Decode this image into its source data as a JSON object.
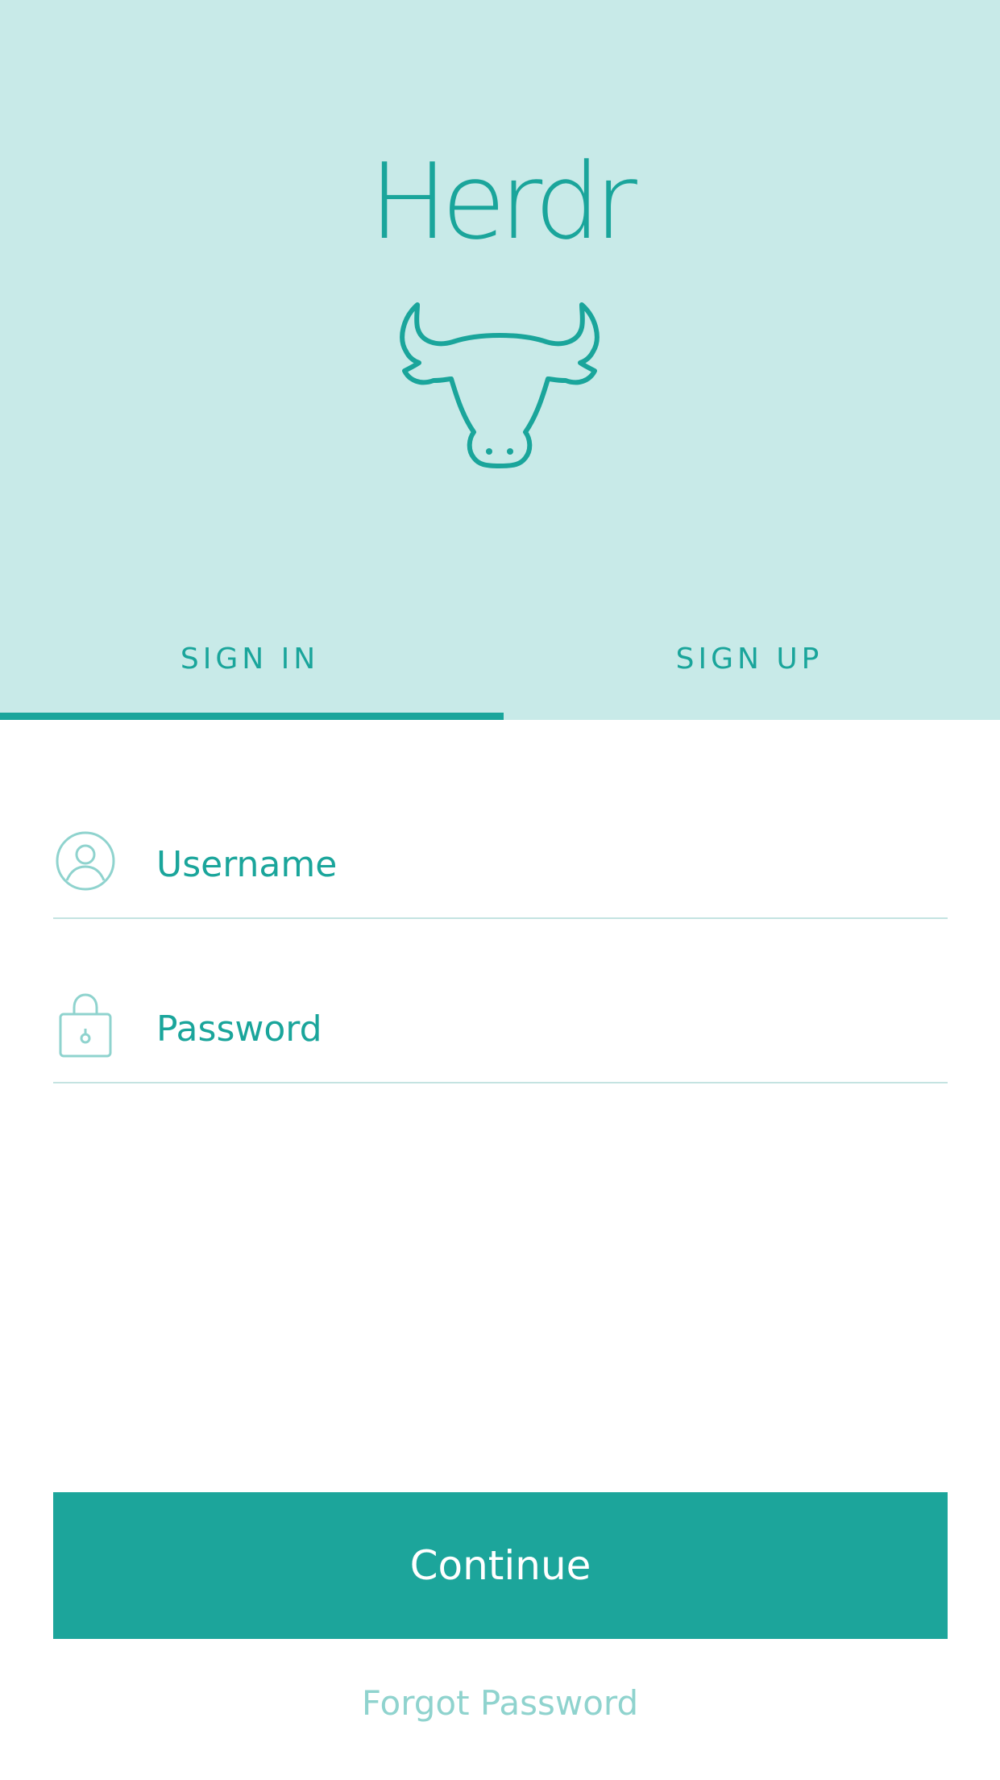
{
  "app": {
    "title": "Herdr",
    "logo_icon": "bull-head-icon"
  },
  "tabs": [
    {
      "label": "SIGN IN",
      "active": true
    },
    {
      "label": "SIGN UP",
      "active": false
    }
  ],
  "form": {
    "username": {
      "placeholder": "Username",
      "value": "",
      "icon": "user-circle-icon"
    },
    "password": {
      "placeholder": "Password",
      "value": "",
      "icon": "lock-icon"
    }
  },
  "actions": {
    "continue_label": "Continue",
    "forgot_label": "Forgot Password"
  },
  "colors": {
    "accent": "#1aa59b",
    "header_bg": "#c8eae8",
    "muted_accent": "#8fd3ce",
    "divider": "#c4e3e1"
  }
}
